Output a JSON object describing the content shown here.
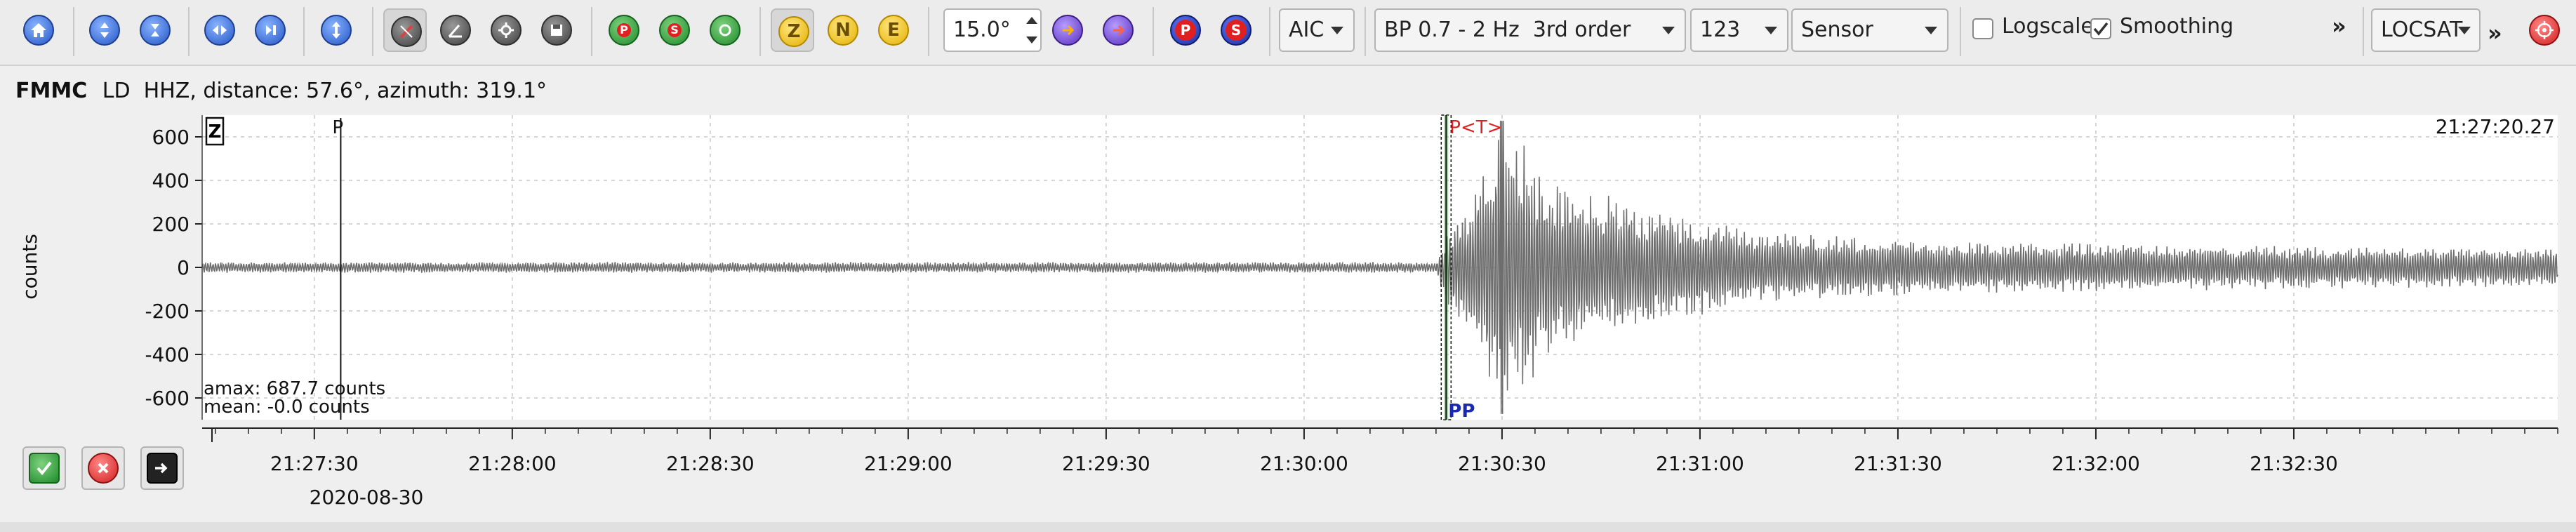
{
  "toolbar": {
    "home_icon": "home-icon",
    "zoom_buttons": [
      "zoom-in-vertical-icon",
      "zoom-out-vertical-icon"
    ],
    "nav_buttons": [
      "previous-icon",
      "next-icon"
    ],
    "amplitude_icon": "amplitude-scale-icon",
    "tool_icons": [
      "pick-tool-icon",
      "measure-tool-icon",
      "settings-tool-icon",
      "save-tool-icon"
    ],
    "phase_picks": [
      {
        "name": "pick-p-icon",
        "letter": "P"
      },
      {
        "name": "pick-s-icon",
        "letter": "S"
      },
      {
        "name": "pick-automatic-icon",
        "letter": ""
      }
    ],
    "components": [
      {
        "name": "component-z",
        "letter": "Z",
        "active": true
      },
      {
        "name": "component-n",
        "letter": "N",
        "active": false
      },
      {
        "name": "component-e",
        "letter": "E",
        "active": false
      }
    ],
    "rotation_value": "15.0°",
    "arrival_icons": [
      "show-theoretical-arrivals-icon",
      "show-unassociated-arrivals-icon"
    ],
    "phase_buttons": [
      "P",
      "S"
    ],
    "picker_method": "AIC",
    "filter": "BP 0.7 - 2 Hz  3rd order",
    "channel_order": "123",
    "unit_mode": "Sensor",
    "logscale_label": "Logscale",
    "logscale_checked": false,
    "smoothing_label": "Smoothing",
    "smoothing_checked": true,
    "overflow_label": "»",
    "locator": "LOCSAT",
    "locator_overflow": "»",
    "relocate_icon": "relocate-target-icon"
  },
  "station": {
    "code": "FMMC",
    "channel": "LD  HHZ, distance: 57.6°, azimuth: 319.1°"
  },
  "plot": {
    "component_label": "Z",
    "ylabel": "counts",
    "yticks": [
      "600",
      "400",
      "200",
      "0",
      "-200",
      "-400",
      "-600"
    ],
    "xticks": [
      "21:27:30",
      "21:28:00",
      "21:28:30",
      "21:29:00",
      "21:29:30",
      "21:30:00",
      "21:30:30",
      "21:31:00",
      "21:31:30",
      "21:32:00",
      "21:32:30"
    ],
    "date_label": "2020-08-30",
    "time_readout": "21:27:20.27",
    "stats_amax": "amax: 687.7 counts",
    "stats_mean": "mean: -0.0 counts",
    "pick_p_label": "P",
    "pick_pt_label": "P<T>",
    "pick_bottom_label": "PP",
    "colors": {
      "trace": "#6e6e6e",
      "grid": "#c8c8c8",
      "theoretical_pick": "#e02020",
      "automatic_pick": "#1a2ab0",
      "green_band": "#6dbe6d"
    }
  },
  "chart_data": {
    "type": "line",
    "title": "",
    "xlabel": "",
    "ylabel": "counts",
    "xlim": [
      "21:27:13",
      "21:33:10"
    ],
    "ylim": [
      -700,
      700
    ],
    "yticks": [
      600,
      400,
      200,
      0,
      -200,
      -400,
      -600
    ],
    "x_tick_labels": [
      "21:27:30",
      "21:28:00",
      "21:28:30",
      "21:29:00",
      "21:29:30",
      "21:30:00",
      "21:30:30",
      "21:31:00",
      "21:31:30",
      "21:32:00",
      "21:32:30"
    ],
    "grid": true,
    "series": [
      {
        "values_envelope": {
          "x": [
            "21:27:13",
            "21:30:20",
            "21:30:22",
            "21:30:25",
            "21:30:30",
            "21:30:38",
            "21:30:50",
            "21:31:10",
            "21:31:40",
            "21:32:30",
            "21:33:10"
          ],
          "peak_amplitude": [
            25,
            25,
            200,
            300,
            687.7,
            400,
            300,
            160,
            120,
            100,
            90
          ]
        }
      }
    ],
    "picks": [
      {
        "label": "P",
        "time": "21:27:34"
      },
      {
        "label": "P<T>",
        "time": "21:30:21"
      },
      {
        "label": "PP",
        "time": "21:30:21"
      }
    ],
    "stats": {
      "amax_counts": 687.7,
      "mean_counts": -0.0
    }
  },
  "bottom_buttons": [
    {
      "name": "accept-button",
      "icon": "checkmark-icon"
    },
    {
      "name": "reject-button",
      "icon": "cancel-icon"
    },
    {
      "name": "forward-button",
      "icon": "forward-arrow-icon"
    }
  ]
}
